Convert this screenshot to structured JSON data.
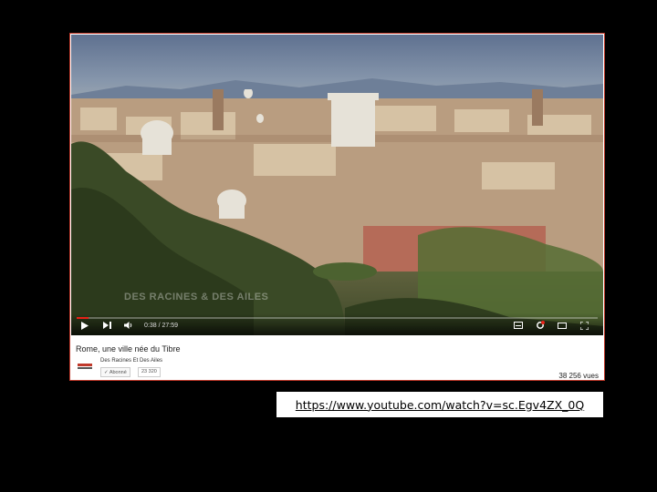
{
  "video": {
    "watermark": "DES RACINES & DES AILES",
    "time": "0:38 / 27:59",
    "progress_fraction": 0.023,
    "accent_color": "#e62117"
  },
  "controls": {
    "icons": [
      "play-icon",
      "next-icon",
      "volume-icon",
      "subtitles-icon",
      "settings-icon",
      "theater-icon",
      "fullscreen-icon"
    ]
  },
  "info": {
    "title": "Rome, une ville née du Tibre",
    "channel": "Des Racines Et Des Ailes",
    "subscribe_label": "✓ Abonné",
    "subscriber_count": "23 320",
    "views": "38 256 vues"
  },
  "link": {
    "url": "https://www.youtube.com/watch?v=sc.Egv4ZX_0Q"
  }
}
